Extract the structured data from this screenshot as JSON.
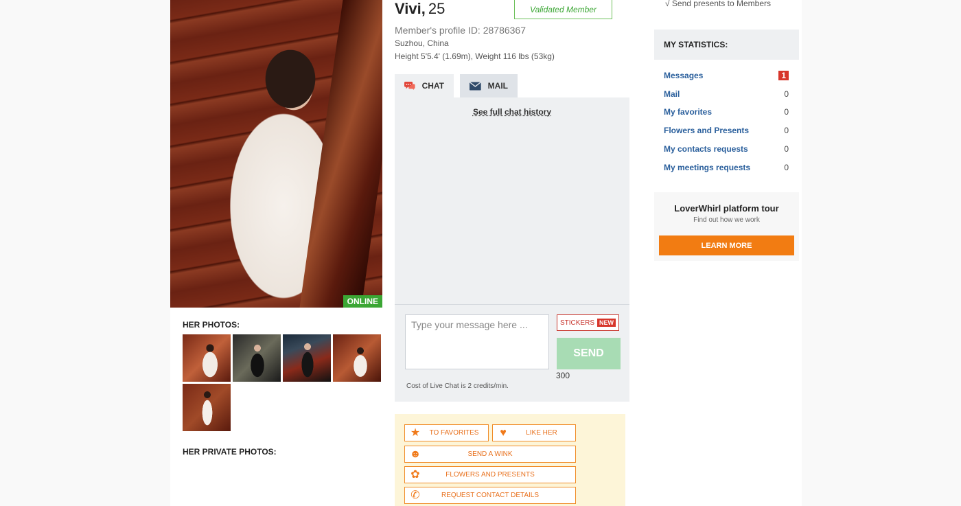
{
  "profile": {
    "name": "Vivi,",
    "age": "25",
    "validated_label": "Validated Member",
    "profile_id": "Member's profile ID: 28786367",
    "location": "Suzhou, China",
    "measures": "Height 5'5.4' (1.69m), Weight 116 lbs (53kg)",
    "online_label": "ONLINE"
  },
  "photos": {
    "her_photos_title": "HER PHOTOS:",
    "private_photos_title": "HER PRIVATE PHOTOS:"
  },
  "tabs": {
    "chat": "CHAT",
    "mail": "MAIL"
  },
  "chat": {
    "history_link": "See full chat history",
    "placeholder": "Type your message here ...",
    "stickers_label": "STICKERS",
    "new_badge": "NEW",
    "send_label": "SEND",
    "char_count": "300",
    "cost_note": "Cost of Live Chat is 2 credits/min."
  },
  "actions": {
    "to_favorites": "TO FAVORITES",
    "like_her": "LIKE HER",
    "send_wink": "SEND A WINK",
    "flowers": "FLOWERS AND PRESENTS",
    "contact": "REQUEST CONTACT DETAILS"
  },
  "sidebar": {
    "presents_line": "√ Send presents to Members",
    "stats_title": "MY STATISTICS:",
    "stats": [
      {
        "label": "Messages",
        "value": "1"
      },
      {
        "label": "Mail",
        "value": "0"
      },
      {
        "label": "My favorites",
        "value": "0"
      },
      {
        "label": "Flowers and Presents",
        "value": "0"
      },
      {
        "label": "My contacts requests",
        "value": "0"
      },
      {
        "label": "My meetings requests",
        "value": "0"
      }
    ],
    "tour_title": "LoverWhirl platform tour",
    "tour_sub": "Find out how we work",
    "learn_more": "LEARN MORE"
  },
  "colors": {
    "accent_orange": "#f27c12",
    "online_green": "#3ba634",
    "badge_red": "#d7362b",
    "link_blue": "#2a5f9c"
  }
}
